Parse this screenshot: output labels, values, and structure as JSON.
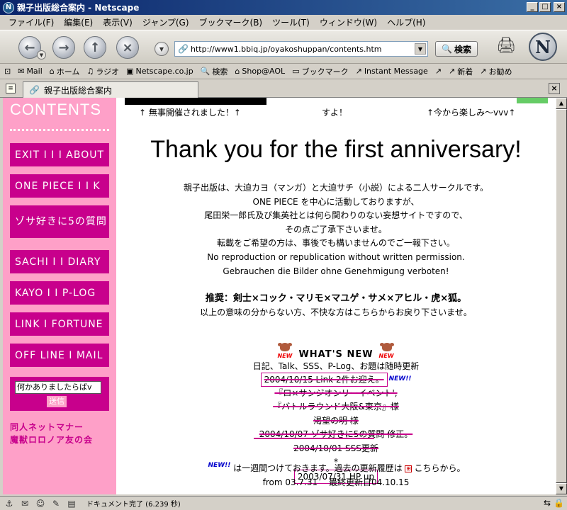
{
  "window": {
    "title": "親子出版総合案内 - Netscape",
    "app_icon": "N"
  },
  "menu": [
    "ファイル(F)",
    "編集(E)",
    "表示(V)",
    "ジャンプ(G)",
    "ブックマーク(B)",
    "ツール(T)",
    "ウィンドウ(W)",
    "ヘルプ(H)"
  ],
  "navbar": {
    "url": "http://www1.bbiq.jp/oyakoshuppan/contents.htm",
    "search_label": "検索",
    "logo": "N"
  },
  "personal_toolbar": [
    "Mail",
    "ホーム",
    "ラジオ",
    "Netscape.co.jp",
    "検索",
    "Shop@AOL",
    "ブックマーク",
    "Instant Message",
    "",
    "新着",
    "お勧め"
  ],
  "tab": {
    "label": "親子出版総合案内"
  },
  "sidebar": {
    "title": "CONTENTS",
    "buttons": [
      "EXIT I I I ABOUT",
      "ONE PIECE I I K",
      "ゾサ好きに5の質問",
      "SACHI I I DIARY",
      "KAYO I I P-LOG",
      "LINK I FORTUNE",
      "OFF LINE I MAIL"
    ],
    "form_value": "何かありましたらばv",
    "form_submit": "送信",
    "links": [
      "同人ネットマナー",
      "魔獣ロロノア友の会"
    ]
  },
  "main": {
    "caption_left": "↑ 無事開催されました！↑",
    "caption_mid": "すよ！",
    "caption_right": "↑今から楽しみ〜vvv↑",
    "title": "Thank you for the first anniversary!",
    "intro": [
      "親子出版は、大迫カヨ（マンガ）と大迫サチ（小説）による二人サークルです。",
      "ONE PIECE を中心に活動しておりますが、",
      "尾田栄一郎氏及び集英社とは何ら関わりのない妄想サイトですので、",
      "その点ご了承下さいませ。",
      "転載をご希望の方は、事後でも構いませんのでご一報下さい。",
      "No reproduction or republication without written permission.",
      "Gebrauchen die Bilder ohne Genehmigung verboten!"
    ],
    "warn_title": "推奨：剣士×コック・マリモ×マユゲ・サメ×アヒル・虎×狐。",
    "warn_text": "以上の意味の分からない方、不快な方はこちらからお戻り下さいませ。",
    "whats_new": "WHAT'S NEW",
    "new_icon": "NEW",
    "whats_new_sub": "日記、Talk、SSS、P-Log、お題は随時更新",
    "news": [
      "2004/10/15 Link 2件お迎え。",
      "『ロ×サンジオンリーイベント',",
      "『バトルラウンド大阪&東京』様",
      "渇望の明 様",
      "2004/10/07 ゾサ好きに5の質問 修正。",
      "2004/10/01 SSS更新",
      "*",
      "2003/07/31 HP up"
    ],
    "news_badge": "NEW!!",
    "footer_badge": "NEW!!",
    "footer_text": "は一週間つけておきます。過去の更新履歴は",
    "footer_link": "こちらから。",
    "since": "from 03.7.31　 最終更新日04.10.15"
  },
  "status": {
    "text": "ドキュメント完了 (6.239 秒)"
  }
}
